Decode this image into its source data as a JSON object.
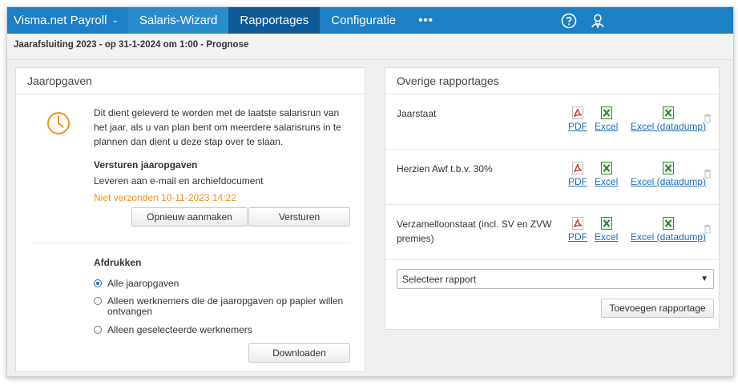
{
  "nav": {
    "brand": "Visma.net Payroll",
    "items": [
      "Salaris-Wizard",
      "Rapportages",
      "Configuratie"
    ],
    "more": "•••"
  },
  "subtitle": "Jaarafsluiting 2023 - op 31-1-2024 om 1:00 - Prognose",
  "jaaropgaven": {
    "title": "Jaaropgaven",
    "intro": "Dit dient geleverd te worden met de laatste salarisrun van het jaar, als u van plan bent om meerdere salarisruns in te plannen dan dient u deze stap over te slaan.",
    "versturen_heading": "Versturen jaaropgaven",
    "versturen_text": "Leveren aan e-mail en archiefdocument",
    "status": "Niet verzonden 10-11-2023 14:22",
    "btn_recreate": "Opnieuw aanmaken",
    "btn_send": "Versturen",
    "afdrukken_heading": "Afdrukken",
    "options": [
      "Alle jaaropgaven",
      "Alleen werknemers die de jaaropgaven op papier willen ontvangen",
      "Alleen geselecteerde werknemers"
    ],
    "selected_option": 0,
    "btn_download": "Downloaden"
  },
  "overige": {
    "title": "Overige rapportages",
    "reports": [
      {
        "name": "Jaarstaat"
      },
      {
        "name": "Herzien Awf t.b.v. 30%"
      },
      {
        "name": "Verzamelloonstaat (incl. SV en ZVW premies)"
      }
    ],
    "formats": {
      "pdf": "PDF",
      "excel": "Excel",
      "datadump": "Excel (datadump)"
    },
    "select_value": "Selecteer rapport",
    "btn_add": "Toevoegen rapportage"
  },
  "colors": {
    "topbar": "#1d7fc4",
    "active_tab": "#0d5a97",
    "status_orange": "#f0931e",
    "link": "#1b6ec2"
  }
}
